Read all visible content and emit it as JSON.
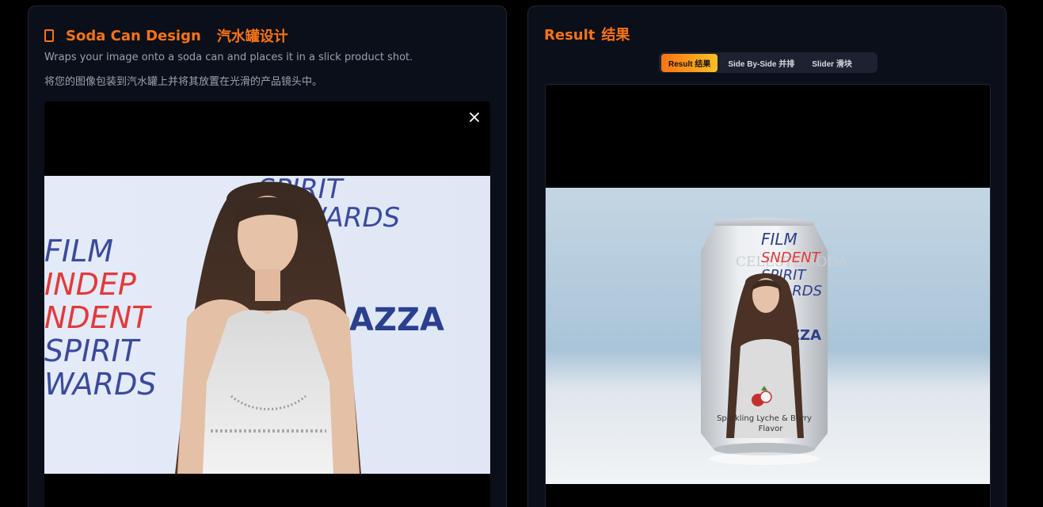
{
  "left_panel": {
    "title_en": "Soda Can Design",
    "title_cn": "汽水罐设计",
    "description_en": "Wraps your image onto a soda can and places it in a slick product shot.",
    "description_cn": "将您的图像包装到汽水罐上并将其放置在光滑的产品镜头中。",
    "photo": {
      "backdrop_lines": [
        "FILM",
        "INDEP",
        "NDENT",
        "SPIRIT",
        "WARDS"
      ],
      "backdrop_top": "SPIRIT",
      "backdrop_top2": "AWARDS",
      "sponsor": "AZZA"
    }
  },
  "right_panel": {
    "title_en": "Result",
    "title_cn": "结果",
    "tabs": [
      {
        "label": "Result  结果",
        "active": true
      },
      {
        "label": "Side By-Side  并排",
        "active": false
      },
      {
        "label": "Slider  滑块",
        "active": false
      }
    ],
    "can": {
      "brand": "CELESTE SODA",
      "graphic_lines": [
        "FILM",
        "SNDENT",
        "SPIRIT",
        "WARDS"
      ],
      "sponsor": "ZZA",
      "flavor_line1": "Sparkling Lyche & Berry",
      "flavor_line2": "Flavor"
    }
  },
  "colors": {
    "accent": "#f97316",
    "accent_light": "#fbbf24",
    "panel_bg": "#0b0f19",
    "border": "#1f2532",
    "muted_text": "#9aa1ad"
  }
}
